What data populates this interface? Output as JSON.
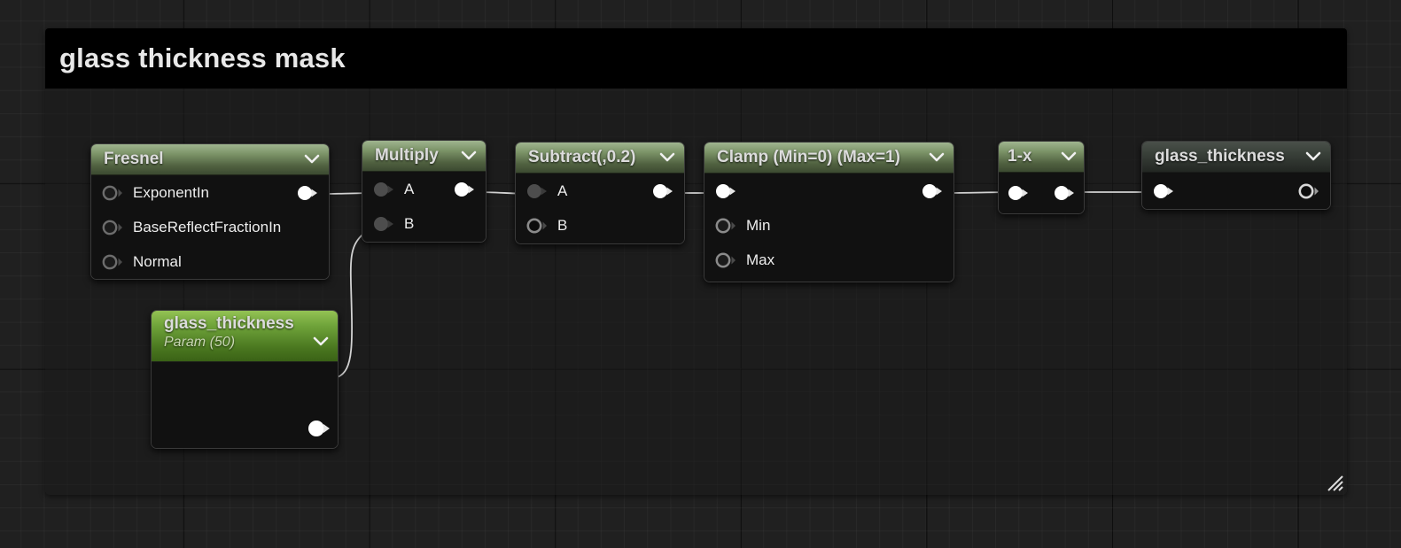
{
  "editor": {
    "title_bar_comment": "glass thickness mask",
    "background_color": "#202020",
    "comment_header_color": "#000000",
    "wire_color": "#d2d2d2",
    "accent_header_color": "#7c9468",
    "param_header_color": "#6fa33a"
  },
  "comment": {
    "label": "glass thickness mask",
    "resize_handle": "resize-grip-icon"
  },
  "nodes": [
    {
      "id": "fresnel",
      "title": "Fresnel",
      "subtitle": "",
      "header_style": "accent",
      "chevron": "chevron-down-icon",
      "inputs": [
        {
          "label": "ExponentIn",
          "state": "unconnected"
        },
        {
          "label": "BaseReflectFractionIn",
          "state": "unconnected"
        },
        {
          "label": "Normal",
          "state": "unconnected"
        }
      ],
      "outputs": [
        {
          "label": "",
          "state": "connected"
        }
      ]
    },
    {
      "id": "multiply",
      "title": "Multiply",
      "subtitle": "",
      "header_style": "accent",
      "chevron": "chevron-down-icon",
      "inputs": [
        {
          "label": "A",
          "state": "connected-gray"
        },
        {
          "label": "B",
          "state": "connected-gray"
        }
      ],
      "outputs": [
        {
          "label": "",
          "state": "connected"
        }
      ]
    },
    {
      "id": "subtract",
      "title": "Subtract(,0.2)",
      "subtitle": "",
      "header_style": "accent",
      "chevron": "chevron-down-icon",
      "inputs": [
        {
          "label": "A",
          "state": "connected-gray"
        },
        {
          "label": "B",
          "state": "unconnected"
        }
      ],
      "outputs": [
        {
          "label": "",
          "state": "connected"
        }
      ]
    },
    {
      "id": "clamp",
      "title": "Clamp (Min=0) (Max=1)",
      "subtitle": "",
      "header_style": "accent",
      "chevron": "chevron-down-icon",
      "inputs": [
        {
          "label": "",
          "state": "connected"
        },
        {
          "label": "Min",
          "state": "unconnected"
        },
        {
          "label": "Max",
          "state": "unconnected"
        }
      ],
      "outputs": [
        {
          "label": "",
          "state": "connected"
        }
      ]
    },
    {
      "id": "one-minus-x",
      "title": "1-x",
      "subtitle": "",
      "header_style": "accent",
      "chevron": "chevron-down-icon",
      "inputs": [
        {
          "label": "",
          "state": "connected"
        }
      ],
      "outputs": [
        {
          "label": "",
          "state": "connected"
        }
      ]
    },
    {
      "id": "glass-thickness-output",
      "title": "glass_thickness",
      "subtitle": "",
      "header_style": "dim",
      "chevron": "chevron-down-icon",
      "inputs": [
        {
          "label": "",
          "state": "connected"
        }
      ],
      "outputs": [
        {
          "label": "",
          "state": "unconnected"
        }
      ]
    },
    {
      "id": "glass-thickness-param",
      "title": "glass_thickness",
      "subtitle": "Param (50)",
      "header_style": "bright",
      "chevron": "chevron-down-icon",
      "inputs": [],
      "outputs": [
        {
          "label": "",
          "state": "connected"
        }
      ]
    }
  ]
}
